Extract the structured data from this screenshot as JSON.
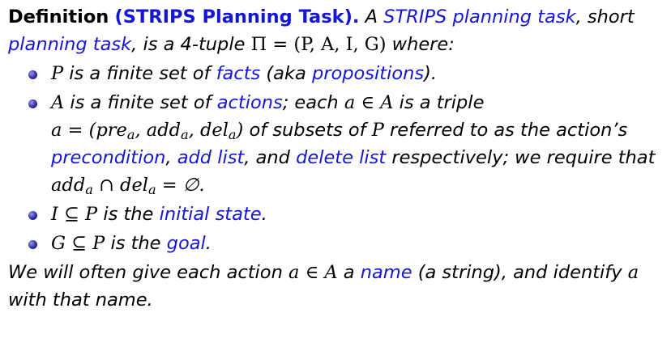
{
  "definition": {
    "label": "Definition",
    "title": "(STRIPS Planning Task).",
    "intro_1": "A",
    "term_1": "STRIPS planning task",
    "intro_2": ", short",
    "term_2": "planning task",
    "intro_3": ", is a 4-tuple",
    "tuple": "Π = (P, A, I, G)",
    "intro_4": "where:"
  },
  "items": [
    {
      "sym": "P",
      "t1": "is a finite set of",
      "k1": "facts",
      "t2": "(aka",
      "k2": "propositions",
      "t3": ")."
    },
    {
      "sym": "A",
      "t1": "is a finite set of",
      "k1": "actions",
      "t2": "; each",
      "m1": "a ∈ A",
      "t3": "is a triple",
      "m2_a": "a = (pre",
      "m2_sub1": "a",
      "m2_b": ", add",
      "m2_sub2": "a",
      "m2_c": ", del",
      "m2_sub3": "a",
      "m2_d": ")",
      "t4": "of subsets of",
      "m3": "P",
      "t5": "referred to as the action’s",
      "k2": "precondition",
      "t6": ",",
      "k3": "add list",
      "t7": ", and",
      "k4": "delete list",
      "t8": "respectively; we require that",
      "m4_a": "add",
      "m4_sub1": "a",
      "m4_b": " ∩ del",
      "m4_sub2": "a",
      "m4_c": " = ∅."
    },
    {
      "sym": "I ⊆ P",
      "t1": "is the",
      "k1": "initial state",
      "t2": "."
    },
    {
      "sym": "G ⊆ P",
      "t1": "is the",
      "k1": "goal",
      "t2": "."
    }
  ],
  "closing": {
    "t1": "We will often give each action",
    "m1": "a ∈ A",
    "t2": "a",
    "k1": "name",
    "t3": "(a string), and identify",
    "m2": "a",
    "t4": "with that name."
  },
  "colors": {
    "accent": "#1515d6",
    "text": "#000000",
    "bullet": "#2d2da8"
  }
}
